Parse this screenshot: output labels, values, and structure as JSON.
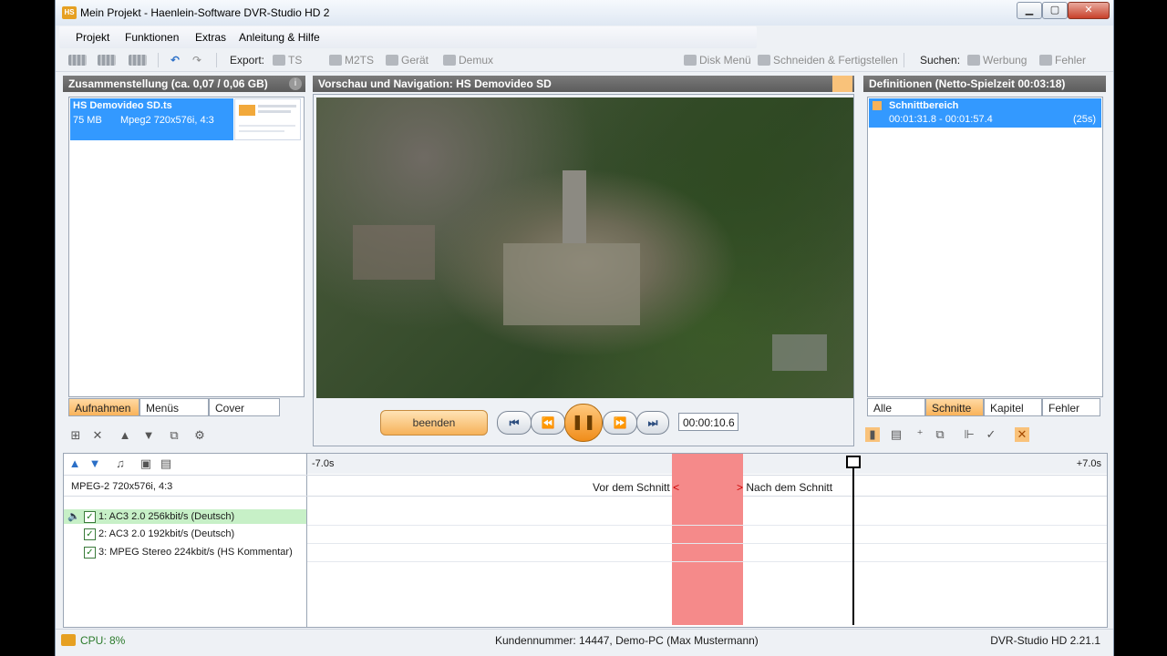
{
  "window": {
    "title": "Mein Projekt - Haenlein-Software DVR-Studio HD 2",
    "minimize": "▁",
    "maximize": "▢",
    "close": "✕"
  },
  "menu": [
    "Projekt",
    "Funktionen",
    "Extras",
    "Anleitung & Hilfe"
  ],
  "toolbar": {
    "export_label": "Export:",
    "ts": "TS",
    "m2ts": "M2TS",
    "geraet": "Gerät",
    "demux": "Demux",
    "disk_menu": "Disk Menü",
    "schneiden": "Schneiden & Fertigstellen",
    "suchen_label": "Suchen:",
    "werbung": "Werbung",
    "fehler": "Fehler"
  },
  "left_panel": {
    "header": "Zusammenstellung (ca. 0,07 / 0,06 GB)",
    "info_icon": "i",
    "item": {
      "name": "HS Demovideo SD.ts",
      "size": "75 MB",
      "format": "Mpeg2 720x576i, 4:3"
    },
    "tabs": [
      "Aufnahmen",
      "Menüs",
      "Cover"
    ]
  },
  "preview": {
    "header": "Vorschau und Navigation: HS Demovideo SD",
    "end_button": "beenden",
    "timecode": "00:00:10.6"
  },
  "right_panel": {
    "header": "Definitionen (Netto-Spielzeit 00:03:18)",
    "item": {
      "title": "Schnittbereich",
      "range": "00:01:31.8 - 00:01:57.4",
      "duration": "(25s)"
    },
    "tabs": [
      "Alle",
      "Schnitte",
      "Kapitel",
      "Fehler"
    ]
  },
  "timeline": {
    "left_time": "-7.0s",
    "right_time": "+7.0s",
    "video_track": "MPEG-2 720x576i, 4:3",
    "before_cut": "Vor dem Schnitt",
    "after_cut": "Nach dem Schnitt",
    "audio_tracks": [
      "1: AC3 2.0 256kbit/s (Deutsch)",
      "2: AC3 2.0 192kbit/s (Deutsch)",
      "3: MPEG Stereo 224kbit/s (HS Kommentar)"
    ]
  },
  "status": {
    "cpu": "CPU: 8%",
    "customer": "Kundennummer: 14447, Demo-PC (Max Mustermann)",
    "version": "DVR-Studio HD 2.21.1"
  },
  "colors": {
    "accent_orange": "#f9b35a",
    "selection_blue": "#3399ff",
    "cut_region": "#f58a8a",
    "header_gray": "#666666"
  }
}
